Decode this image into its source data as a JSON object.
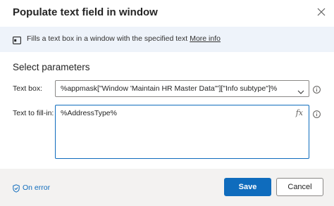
{
  "dialog": {
    "title": "Populate text field in window"
  },
  "info": {
    "text": "Fills a text box in a window with the specified text",
    "link": "More info"
  },
  "section_title": "Select parameters",
  "fields": {
    "text_box": {
      "label": "Text box:",
      "value": "%appmask[\"Window 'Maintain HR Master Data'\"][\"Info subtype\"]%"
    },
    "text_to_fill": {
      "label": "Text to fill-in:",
      "value": "%AddressType%",
      "fx_label": "fx"
    }
  },
  "footer": {
    "on_error": "On error",
    "save": "Save",
    "cancel": "Cancel"
  },
  "colors": {
    "accent": "#0f6cbd",
    "info_bar": "#eef3fa",
    "footer_bg": "#f3f2f1"
  }
}
